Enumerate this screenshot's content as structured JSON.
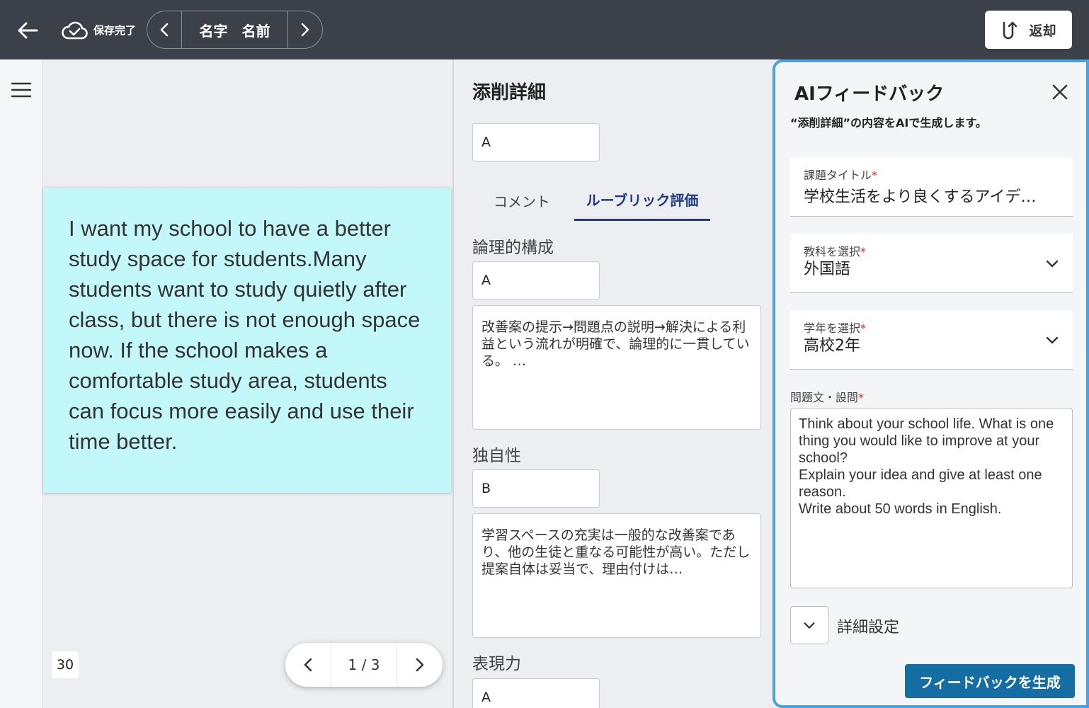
{
  "topbar": {
    "save_status": "保存完了",
    "student_name": "名字　名前",
    "return_label": "返却"
  },
  "document": {
    "essay_text": "I want my school to have a better study space for students.Many students want to study quietly after class, but there is not enough space now. If the school makes a comfortable study area, students can focus more easily and use their time better.",
    "page_badge": "30",
    "pager_label": "1 / 3"
  },
  "correction": {
    "heading": "添削詳細",
    "overall_grade": "A",
    "tabs": [
      {
        "label": "コメント",
        "active": false
      },
      {
        "label": "ルーブリック評価",
        "active": true
      }
    ],
    "rubric": [
      {
        "label": "論理的構成",
        "grade": "A",
        "comment": "改善案の提示→問題点の説明→解決による利益という流れが明確で、論理的に一貫している。 …"
      },
      {
        "label": "独自性",
        "grade": "B",
        "comment": "学習スペースの充実は一般的な改善案であり、他の生徒と重なる可能性が高い。ただし提案自体は妥当で、理由付けは…"
      },
      {
        "label": "表現力",
        "grade": "A"
      }
    ]
  },
  "ai_panel": {
    "title": "AIフィードバック",
    "subtitle": "“添削詳細”の内容をAIで生成します。",
    "fields": {
      "task_title": {
        "label": "課題タイトル",
        "value": "学校生活をより良くするアイデ…"
      },
      "subject": {
        "label": "教科を選択",
        "value": "外国語"
      },
      "grade": {
        "label": "学年を選択",
        "value": "高校2年"
      }
    },
    "question_label": "問題文・設問",
    "question_text": "Think about your school life. What is one thing you would like to improve at your school?\nExplain your idea and give at least one reason.\nWrite about 50 words in English.",
    "detail_settings_label": "詳細設定",
    "generate_label": "フィードバックを生成"
  },
  "colors": {
    "topbar": "#3c4049",
    "sticky_note": "#c3f8fa",
    "accent_tab": "#1f3a8a",
    "panel_border": "#4aa2e2",
    "primary_button": "#156ea3",
    "required": "#d32f2f"
  },
  "icons": [
    "back-arrow-icon",
    "cloud-check-icon",
    "chevron-left-icon",
    "chevron-right-icon",
    "return-icon",
    "hamburger-menu-icon",
    "close-icon",
    "chevron-down-icon"
  ]
}
